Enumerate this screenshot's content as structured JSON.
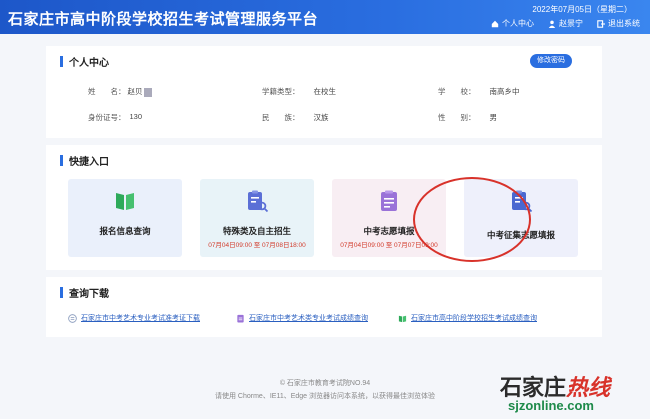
{
  "header": {
    "title": "石家庄市高中阶段学校招生考试管理服务平台",
    "date": "2022年07月05日（星期二）",
    "nav": [
      {
        "label": "个人中心",
        "icon": "home-icon"
      },
      {
        "label": "赵景宁",
        "icon": "user-icon"
      },
      {
        "label": "退出系统",
        "icon": "logout-icon"
      }
    ]
  },
  "personal": {
    "title": "个人中心",
    "edit_label": "修改密码",
    "name_label": "姓　　名：",
    "name_value": "赵贝",
    "roll_label": "学籍类型：",
    "roll_value": "在校生",
    "school_label": "学　　校：",
    "school_value": "南高乡中",
    "id_label": "身份证号：",
    "id_value": "130",
    "nation_label": "民　　族：",
    "nation_value": "汉族",
    "gender_label": "性　　别：",
    "gender_value": "男"
  },
  "quick": {
    "title": "快捷入口",
    "cards": [
      {
        "label": "报名信息查询",
        "date": "",
        "icon": "book-icon",
        "bg": "#eaf0fb",
        "color": "#2eaa5a"
      },
      {
        "label": "特殊类及自主招生",
        "date": "07月04日09:00 至 07月08日18:00",
        "icon": "clipboard-search-icon",
        "bg": "#e8f3f8",
        "color": "#5b6fd6"
      },
      {
        "label": "中考志愿填报",
        "date": "07月04日09:00 至 07月07日09:00",
        "icon": "clipboard-icon",
        "bg": "#f8eef3",
        "color": "#9a72d8"
      },
      {
        "label": "中考征集志愿填报",
        "date": "",
        "icon": "clipboard-search-icon",
        "bg": "#eef0fb",
        "color": "#4a68d0"
      }
    ]
  },
  "downloads": {
    "title": "查询下载",
    "links": [
      {
        "label": "石家庄市中考艺术专业考试准考证下载",
        "icon": "document-icon",
        "color": "#8fa0c0"
      },
      {
        "label": "石家庄市中考艺术类专业考试成绩查询",
        "icon": "clipboard-icon",
        "color": "#9a72d8"
      },
      {
        "label": "石家庄市高中阶段学校招生考试成绩查询",
        "icon": "book-icon",
        "color": "#2eaa5a"
      }
    ]
  },
  "footer": {
    "copyright": "© 石家庄市教育考试院NO.94",
    "note": "请使用 Chorme、IE11、Edge 浏览器访问本系统，以获得最佳浏览体验"
  },
  "watermark": {
    "logo_black": "石家庄",
    "logo_red": "热线",
    "url": "sjzonline.com"
  }
}
